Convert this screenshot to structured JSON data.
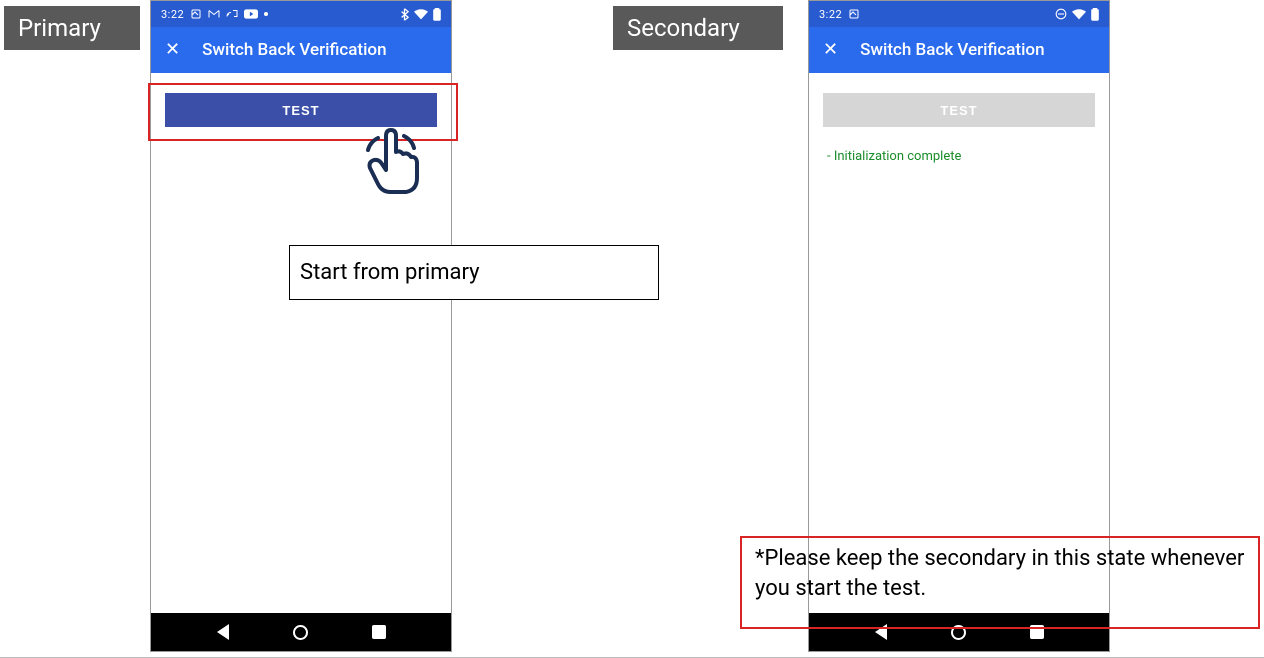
{
  "tags": {
    "primary": "Primary",
    "secondary": "Secondary"
  },
  "primary_phone": {
    "status_bar": {
      "time": "3:22",
      "icons_left": "⌂ ⋈ Ψ ▶ •",
      "icons_right": "✱ ▼ ▮"
    },
    "app_bar": {
      "close": "✕",
      "title": "Switch Back Verification"
    },
    "test_button": {
      "label": "TEST",
      "enabled": true
    },
    "status_message": ""
  },
  "secondary_phone": {
    "status_bar": {
      "time": "3:22",
      "icons_left": "⌂",
      "icons_right": "⊖ ▼ ▮"
    },
    "app_bar": {
      "close": "✕",
      "title": "Switch Back Verification"
    },
    "test_button": {
      "label": "TEST",
      "enabled": false
    },
    "status_message": "- Initialization complete"
  },
  "captions": {
    "primary_note": "Start from primary",
    "secondary_note": "*Please keep the secondary in this state whenever you start the test."
  },
  "colors": {
    "status_bar": "#285bd0",
    "app_bar": "#2a6bed",
    "button_enabled": "#3b4fa8",
    "button_disabled": "#d6d6d6",
    "success_text": "#1a8c2a",
    "highlight_red": "#d92424",
    "tag_bg": "#595959"
  }
}
